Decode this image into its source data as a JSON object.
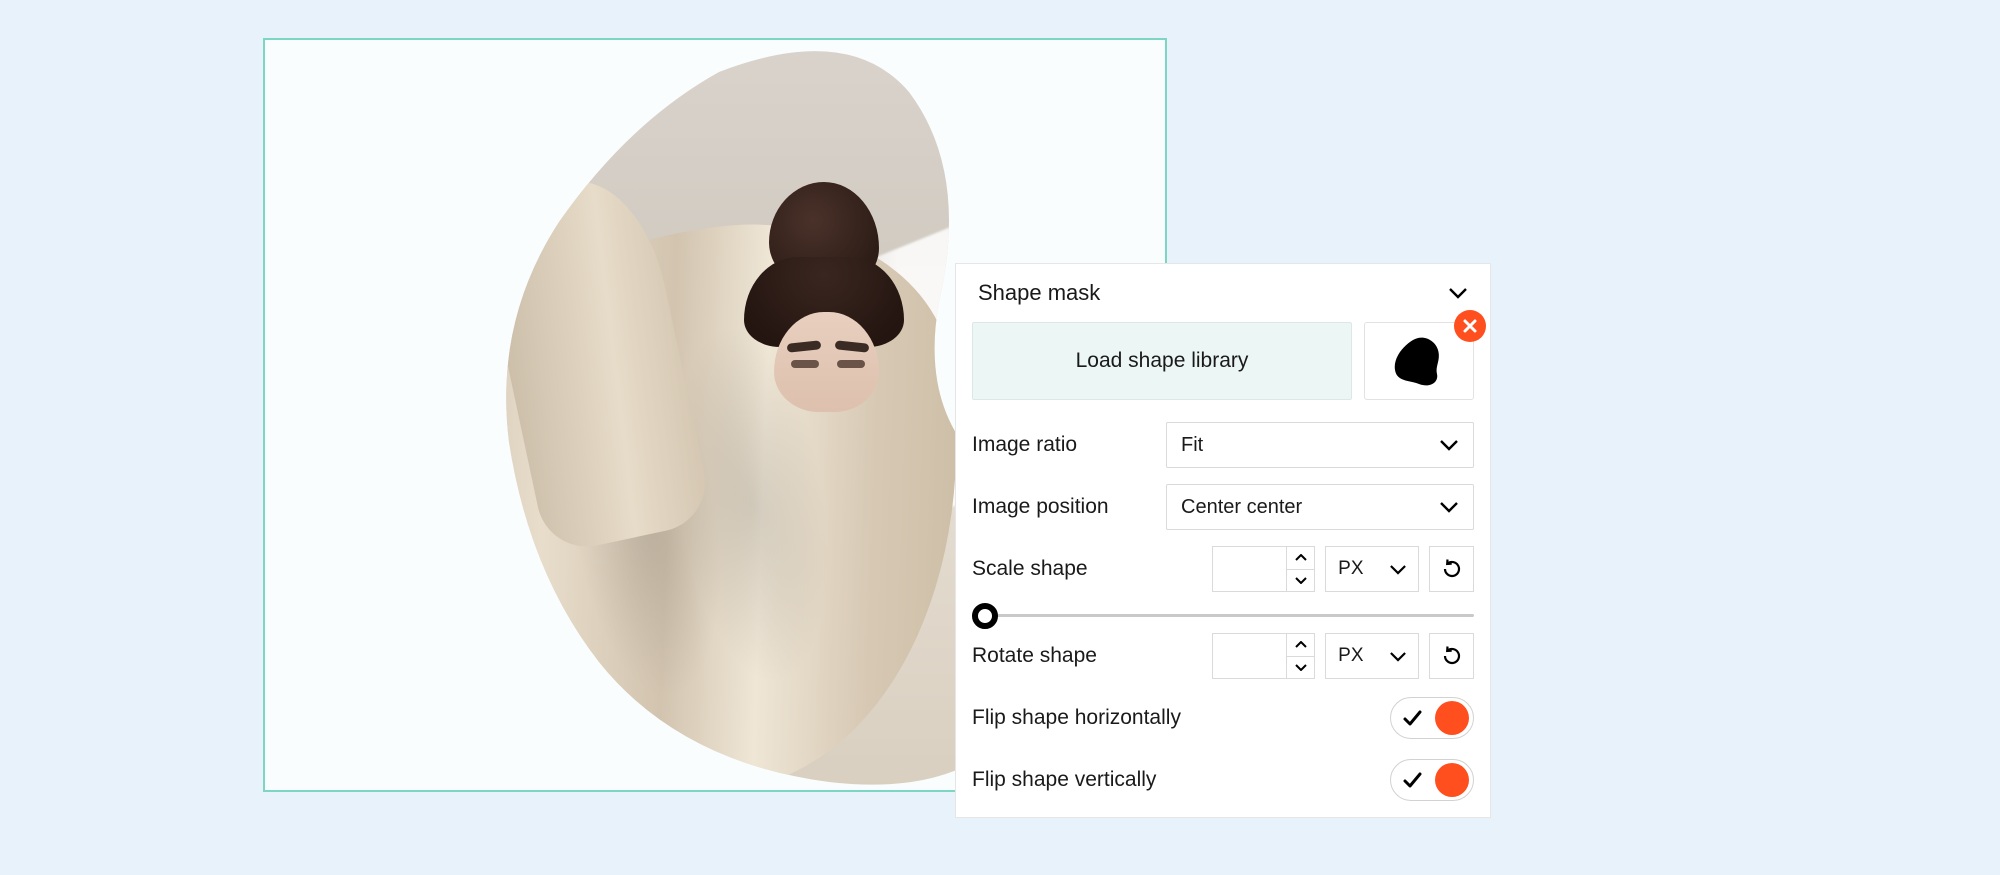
{
  "panel": {
    "title": "Shape mask",
    "load_button": "Load shape library",
    "image_ratio": {
      "label": "Image ratio",
      "value": "Fit"
    },
    "image_position": {
      "label": "Image position",
      "value": "Center center"
    },
    "scale_shape": {
      "label": "Scale shape",
      "value": "",
      "unit": "PX"
    },
    "rotate_shape": {
      "label": "Rotate shape",
      "value": "",
      "unit": "PX"
    },
    "flip_horizontal": {
      "label": "Flip shape horizontally",
      "on": true
    },
    "flip_vertical": {
      "label": "Flip shape vertically",
      "on": true
    }
  },
  "colors": {
    "accent": "#ff4f1f",
    "canvas_border": "#7dd6c3",
    "page_bg": "#e8f2fb",
    "load_bg": "#ecf6f5"
  }
}
